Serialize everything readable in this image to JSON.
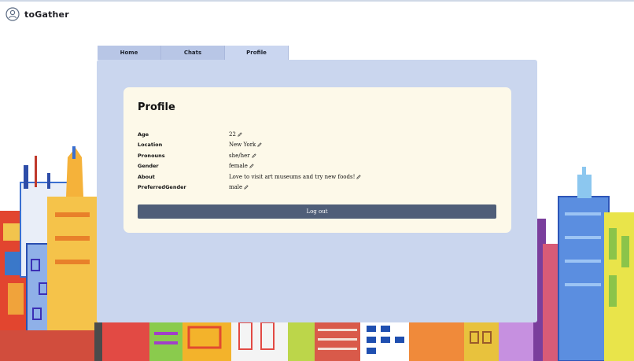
{
  "header": {
    "app_title": "toGather"
  },
  "tabs": [
    {
      "label": "Home",
      "active": false
    },
    {
      "label": "Chats",
      "active": false
    },
    {
      "label": "Profile",
      "active": true
    }
  ],
  "profile": {
    "title": "Profile",
    "fields": [
      {
        "label": "Age",
        "value": "22"
      },
      {
        "label": "Location",
        "value": "New York"
      },
      {
        "label": "Pronouns",
        "value": "she/her"
      },
      {
        "label": "Gender",
        "value": "female"
      },
      {
        "label": "About",
        "value": "Love to visit art museums and try new foods!"
      },
      {
        "label": "PreferredGender",
        "value": "male"
      }
    ],
    "logout_label": "Log out"
  },
  "colors": {
    "panel": "#cad6ee",
    "card": "#fdf9e9",
    "tab": "#b8c6e6",
    "tab_active": "#cad6f0",
    "button": "#4f5e78"
  },
  "icons": {
    "logo": "person-circle-icon",
    "edit": "pencil-icon"
  }
}
